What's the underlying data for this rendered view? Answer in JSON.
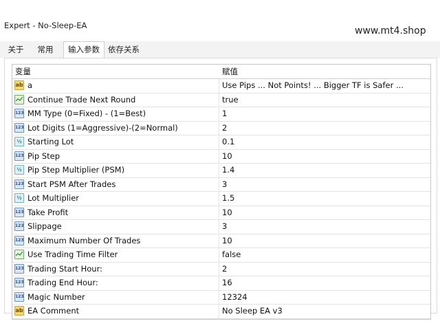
{
  "window": {
    "title": "Expert - No-Sleep-EA"
  },
  "watermark": "www.mt4.shop",
  "tabs": [
    "关于",
    "常用",
    "输入参数",
    "依存关系"
  ],
  "table": {
    "headers": {
      "variable": "变量",
      "value": "赋值"
    },
    "rows": [
      {
        "icon": "ab",
        "name": "a",
        "value": "Use Pips ... Not Points! ... Bigger TF is Safer ..."
      },
      {
        "icon": "bool",
        "name": "Continue Trade Next Round",
        "value": "true"
      },
      {
        "icon": "int",
        "name": "MM Type (0=Fixed) - (1=Best)",
        "value": "1"
      },
      {
        "icon": "int",
        "name": "Lot Digits (1=Aggressive)-(2=Normal)",
        "value": "2"
      },
      {
        "icon": "dbl",
        "name": "Starting Lot",
        "value": "0.1"
      },
      {
        "icon": "int",
        "name": "Pip Step",
        "value": "10"
      },
      {
        "icon": "dbl",
        "name": "Pip Step Multiplier (PSM)",
        "value": "1.4"
      },
      {
        "icon": "int",
        "name": "Start PSM After Trades",
        "value": "3"
      },
      {
        "icon": "dbl",
        "name": "Lot Multiplier",
        "value": "1.5"
      },
      {
        "icon": "int",
        "name": "Take Profit",
        "value": "10"
      },
      {
        "icon": "int",
        "name": "Slippage",
        "value": "3"
      },
      {
        "icon": "int",
        "name": "Maximum Number Of Trades",
        "value": "10"
      },
      {
        "icon": "bool",
        "name": "Use Trading Time Filter",
        "value": "false"
      },
      {
        "icon": "int",
        "name": "Trading Start Hour:",
        "value": "2"
      },
      {
        "icon": "int",
        "name": "Trading End Hour:",
        "value": "16"
      },
      {
        "icon": "int",
        "name": "Magic Number",
        "value": "12324"
      },
      {
        "icon": "ab",
        "name": "EA Comment",
        "value": "No Sleep EA v3"
      }
    ]
  }
}
